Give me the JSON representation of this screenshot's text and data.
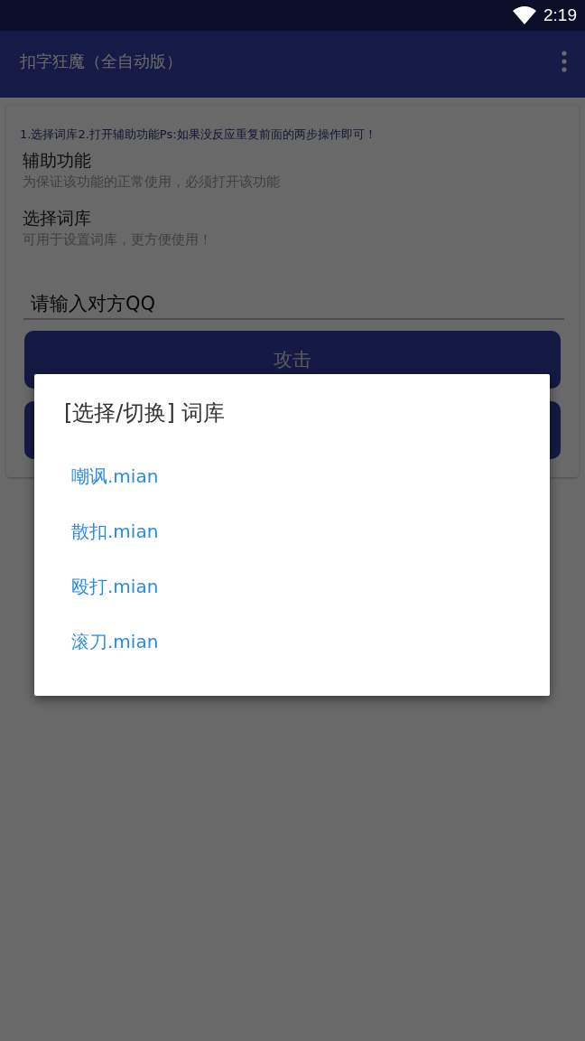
{
  "status_bar": {
    "time": "2:19"
  },
  "app_bar": {
    "title": "扣字狂魔（全自动版）"
  },
  "card": {
    "instructions": "1.选择词库2.打开辅助功能Ps:如果没反应重复前面的两步操作即可！",
    "settings": [
      {
        "title": "辅助功能",
        "summary": "为保证该功能的正常使用，必须打开该功能"
      },
      {
        "title": "选择词库",
        "summary": "可用于设置词库，更方便使用！"
      }
    ],
    "qq_field": {
      "value": "请输入对方QQ"
    },
    "buttons": [
      {
        "kind": "filled",
        "label": "攻击"
      },
      {
        "kind": "filled"
      }
    ]
  },
  "dialog": {
    "title": "[选择/切换] 词库",
    "items": [
      {
        "label": "嘲讽.mian"
      },
      {
        "label": "散扣.mian"
      },
      {
        "label": "殴打.mian"
      },
      {
        "label": "滚刀.mian"
      }
    ]
  }
}
